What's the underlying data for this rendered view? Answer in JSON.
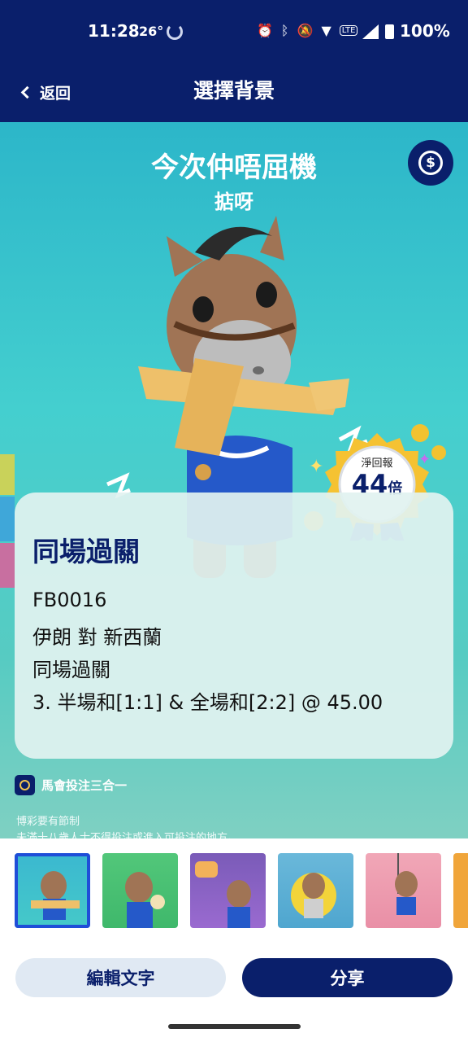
{
  "status_bar": {
    "time": "11:28",
    "temperature": "26°",
    "battery": "100%",
    "icons": [
      "alarm-icon",
      "bluetooth-icon",
      "mute-icon",
      "wifi-icon",
      "volte-icon",
      "signal-icon",
      "battery-icon"
    ]
  },
  "header": {
    "back_label": "返回",
    "title": "選擇背景"
  },
  "hero": {
    "title": "今次仲唔屈機",
    "subtitle": "掂呀",
    "reward_icon": "reward-ribbon-icon"
  },
  "badge": {
    "label": "淨回報",
    "value": "44",
    "unit": "倍"
  },
  "bet_card": {
    "title": "同場過關",
    "code": "FB0016",
    "match": "伊朗 對 新西蘭",
    "type": "同場過關",
    "selection": "3. 半場和[1:1] & 全場和[2:2] @ 45.00"
  },
  "brand": {
    "name": "馬會投注三合一"
  },
  "disclaimer": {
    "line1": "博彩要有節制",
    "line2": "未滿十八歲人士不得投注或進入可投注的地方。"
  },
  "thumbnails": [
    {
      "name": "horse-plane",
      "selected": true
    },
    {
      "name": "horse-snack",
      "selected": false
    },
    {
      "name": "horse-lantern",
      "selected": false
    },
    {
      "name": "horse-ball",
      "selected": false
    },
    {
      "name": "horse-swing",
      "selected": false
    },
    {
      "name": "horse-partial",
      "selected": false
    }
  ],
  "actions": {
    "edit_label": "編輯文字",
    "share_label": "分享"
  },
  "colors": {
    "primary_navy": "#0a1f6b",
    "hero_teal": "#44cfcf",
    "selected_border": "#1f4ed8"
  }
}
